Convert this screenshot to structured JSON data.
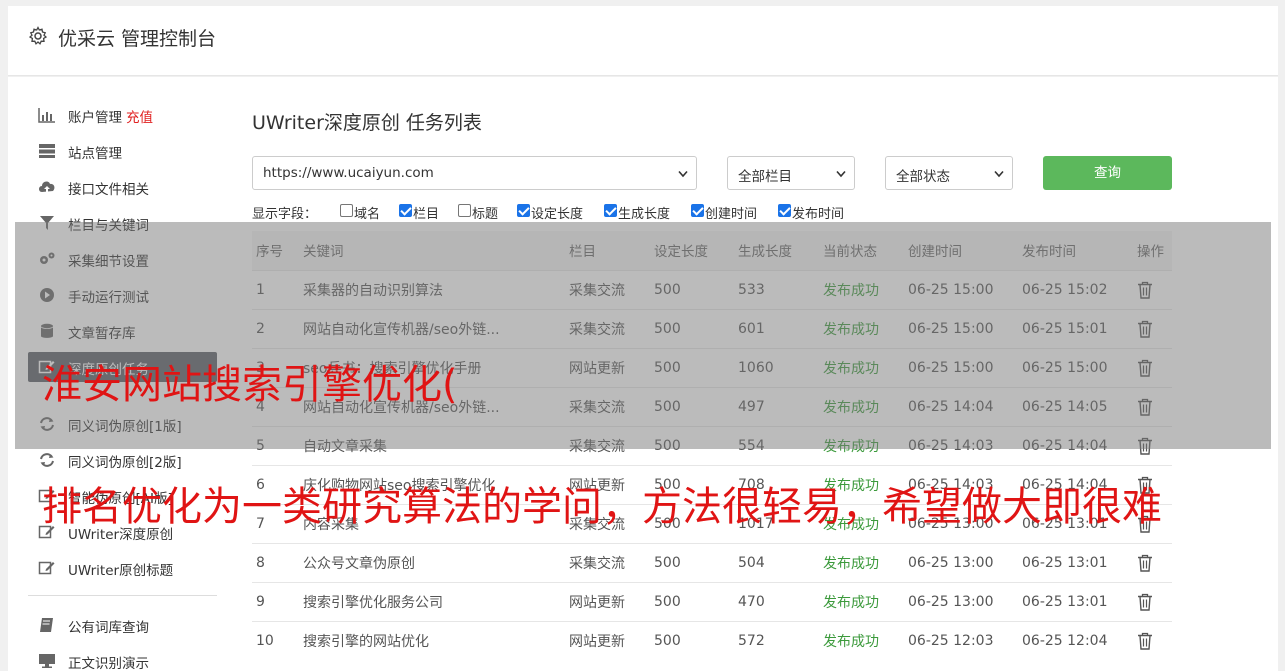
{
  "header": {
    "title": "优采云 管理控制台",
    "icon": "gear-icon"
  },
  "sidebar": {
    "items": [
      {
        "label": "账户管理",
        "extra": "充值",
        "icon": "bar-chart-icon"
      },
      {
        "label": "站点管理",
        "icon": "server-icon"
      },
      {
        "label": "接口文件相关",
        "icon": "cloud-upload-icon"
      },
      {
        "label": "栏目与关键词",
        "icon": "filter-icon"
      },
      {
        "label": "采集细节设置",
        "icon": "cogs-icon"
      },
      {
        "label": "手动运行测试",
        "icon": "play-circle-icon"
      },
      {
        "label": "文章暂存库",
        "icon": "database-icon"
      },
      {
        "label": "深度原创任务",
        "icon": "edit-icon"
      },
      {
        "label": "同义词伪原创[1版]",
        "icon": "refresh-icon"
      },
      {
        "label": "同义词伪原创[2版]",
        "icon": "refresh-icon"
      },
      {
        "label": "智能伪原创[AI版]",
        "icon": "edit-icon"
      },
      {
        "label": "UWriter深度原创",
        "icon": "edit-icon"
      },
      {
        "label": "UWriter原创标题",
        "icon": "edit-icon"
      },
      {
        "label": "公有词库查询",
        "icon": "book-icon"
      },
      {
        "label": "正文识别演示",
        "icon": "monitor-icon"
      }
    ]
  },
  "main": {
    "title": "UWriter深度原创 任务列表",
    "site_select": "https://www.ucaiyun.com",
    "column_select": "全部栏目",
    "status_select": "全部状态",
    "query_label": "查询",
    "fields_label": "显示字段：",
    "fields": [
      {
        "label": "域名",
        "checked": false
      },
      {
        "label": "栏目",
        "checked": true
      },
      {
        "label": "标题",
        "checked": false
      },
      {
        "label": "设定长度",
        "checked": true
      },
      {
        "label": "生成长度",
        "checked": true
      },
      {
        "label": "创建时间",
        "checked": true
      },
      {
        "label": "发布时间",
        "checked": true
      }
    ],
    "columns": [
      "序号",
      "关键词",
      "栏目",
      "设定长度",
      "生成长度",
      "当前状态",
      "创建时间",
      "发布时间",
      "操作"
    ],
    "rows": [
      [
        "1",
        "采集器的自动识别算法",
        "采集交流",
        "500",
        "533",
        "发布成功",
        "06-25 15:00",
        "06-25 15:02"
      ],
      [
        "2",
        "网站自动化宣传机器/seo外链...",
        "采集交流",
        "500",
        "601",
        "发布成功",
        "06-25 15:00",
        "06-25 15:01"
      ],
      [
        "3",
        "seo兵书：搜索引擎优化手册",
        "网站更新",
        "500",
        "1060",
        "发布成功",
        "06-25 15:00",
        "06-25 15:00"
      ],
      [
        "4",
        "网站自动化宣传机器/seo外链...",
        "采集交流",
        "500",
        "497",
        "发布成功",
        "06-25 14:04",
        "06-25 14:05"
      ],
      [
        "5",
        "自动文章采集",
        "采集交流",
        "500",
        "554",
        "发布成功",
        "06-25 14:03",
        "06-25 14:04"
      ],
      [
        "6",
        "庆化购物网站seo搜索引擎优化",
        "网站更新",
        "500",
        "708",
        "发布成功",
        "06-25 14:03",
        "06-25 14:04"
      ],
      [
        "7",
        "内容采集",
        "采集交流",
        "500",
        "1017",
        "发布成功",
        "06-25 13:00",
        "06-25 13:01"
      ],
      [
        "8",
        "公众号文章伪原创",
        "采集交流",
        "500",
        "504",
        "发布成功",
        "06-25 13:00",
        "06-25 13:01"
      ],
      [
        "9",
        "搜索引擎优化服务公司",
        "网站更新",
        "500",
        "470",
        "发布成功",
        "06-25 13:00",
        "06-25 13:01"
      ],
      [
        "10",
        "搜索引擎的网站优化",
        "网站更新",
        "500",
        "572",
        "发布成功",
        "06-25 12:03",
        "06-25 12:04"
      ]
    ]
  },
  "watermark": {
    "line1": "淮安网站搜索引擎优化(",
    "line2": "排名优化为一类研究算法的学问，方法很轻易，希望做大即很难"
  },
  "colors": {
    "accent": "#5cb85c",
    "success": "#3c9a3c",
    "active_nav": "#5a5f66",
    "watermark": "#e01414"
  }
}
